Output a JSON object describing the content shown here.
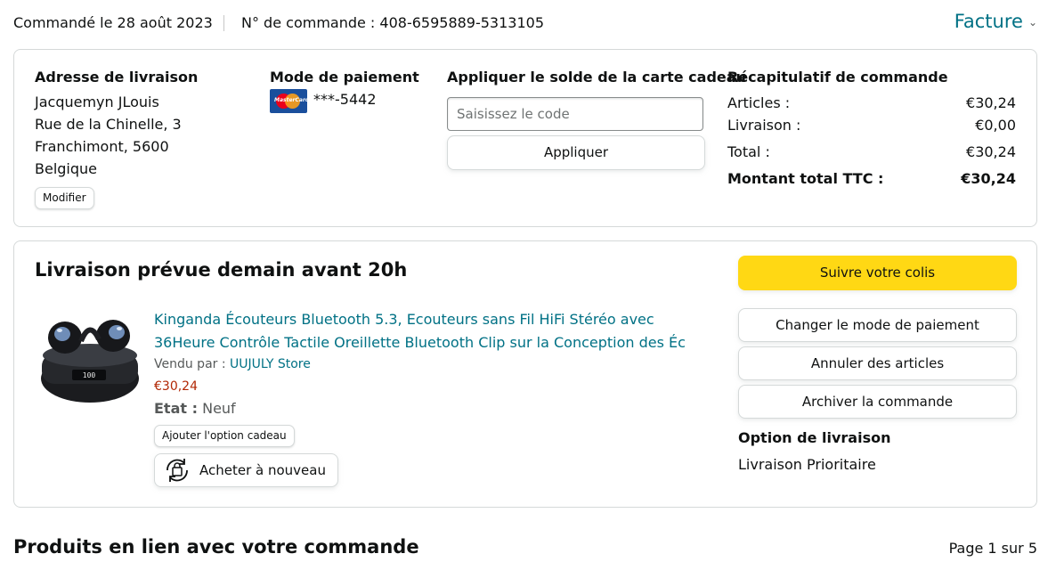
{
  "header": {
    "order_date": "Commandé le 28 août 2023",
    "order_number": "N° de commande : 408-6595889-5313105",
    "invoice_label": "Facture"
  },
  "shipping_address": {
    "title": "Adresse de livraison",
    "lines": [
      "Jacquemyn JLouis",
      "Rue de la Chinelle, 3",
      "Franchimont, 5600",
      "Belgique"
    ],
    "modify_label": "Modifier"
  },
  "payment": {
    "title": "Mode de paiement",
    "card_brand": "MasterCard",
    "card_number": "***-5442",
    "card_colors": {
      "red": "#eb001b",
      "orange": "#f79e1b",
      "background": "#1a4f9c"
    }
  },
  "gift_card": {
    "title": "Appliquer le solde de la carte cadeau",
    "placeholder": "Saisissez le code",
    "apply_label": "Appliquer"
  },
  "summary": {
    "title": "Récapitulatif de commande",
    "rows": [
      {
        "label": "Articles :",
        "value": "€30,24"
      },
      {
        "label": "Livraison :",
        "value": "€0,00"
      },
      {
        "label": "Total :",
        "value": "€30,24"
      },
      {
        "label": "Montant total TTC :",
        "value": "€30,24"
      }
    ]
  },
  "shipment": {
    "title": "Livraison prévue demain avant 20h",
    "product": {
      "title": "Kinganda Écouteurs Bluetooth 5.3, Ecouteurs sans Fil HiFi Stéréo avec 36Heure Contrôle Tactile Oreillette Bluetooth Clip sur la Conception des Éc",
      "sold_by_label": "Vendu par :",
      "seller": "UUJULY Store",
      "price": "€30,24",
      "condition_label": "Etat :",
      "condition": "Neuf",
      "gift_option_label": "Ajouter l'option cadeau",
      "buy_again_label": "Acheter à nouveau",
      "image_icon": "earbuds-product-image"
    },
    "actions": {
      "track": "Suivre votre colis",
      "change_payment": "Changer le mode de paiement",
      "cancel": "Annuler des articles",
      "archive": "Archiver la commande"
    },
    "delivery_option_title": "Option de livraison",
    "delivery_option_value": "Livraison Prioritaire"
  },
  "related": {
    "title": "Produits en lien avec votre commande",
    "page_indicator": "Page 1 sur 5"
  },
  "colors": {
    "link": "#007185",
    "price": "#b12704",
    "primary_button": "#ffd814",
    "border": "#d5d9d9"
  }
}
